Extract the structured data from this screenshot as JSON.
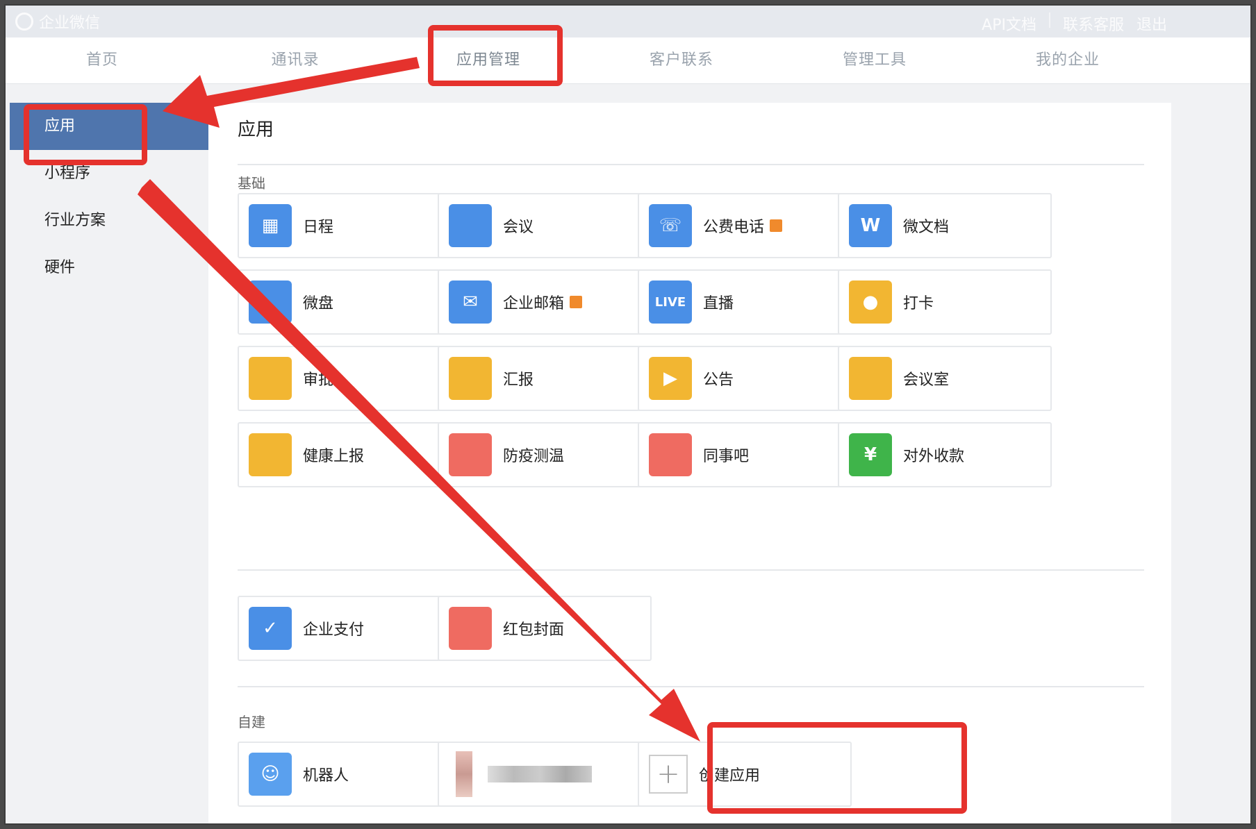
{
  "brand": {
    "name": "企业微信"
  },
  "toplinks": [
    "API文档",
    "联系客服",
    "退出"
  ],
  "nav": [
    "首页",
    "通讯录",
    "应用管理",
    "客户联系",
    "管理工具",
    "我的企业"
  ],
  "sidebar": [
    "应用",
    "小程序",
    "行业方案",
    "硬件"
  ],
  "content": {
    "title": "应用",
    "basic_label": "基础",
    "self_label": "自建",
    "apps": [
      {
        "label": "日程",
        "icon": "calendar-icon",
        "color": "#4a8fe6"
      },
      {
        "label": "会议",
        "icon": "cloud-meeting-icon",
        "color": "#4a8fe6"
      },
      {
        "label": "公费电话",
        "icon": "phone-icon",
        "color": "#4a8fe6",
        "badge": true
      },
      {
        "label": "微文档",
        "icon": "word-icon",
        "color": "#4a8fe6"
      },
      {
        "label": "微盘",
        "icon": "drive-icon",
        "color": "#4a8fe6"
      },
      {
        "label": "企业邮箱",
        "icon": "mail-icon",
        "color": "#4a8fe6",
        "badge": true
      },
      {
        "label": "直播",
        "icon": "live-icon",
        "color": "#4a8fe6"
      },
      {
        "label": "打卡",
        "icon": "location-icon",
        "color": "#f2b632"
      },
      {
        "label": "审批",
        "icon": "stamp-icon",
        "color": "#f2b632"
      },
      {
        "label": "汇报",
        "icon": "report-icon",
        "color": "#f2b632"
      },
      {
        "label": "公告",
        "icon": "megaphone-icon",
        "color": "#f2b632"
      },
      {
        "label": "会议室",
        "icon": "door-icon",
        "color": "#f2b632"
      },
      {
        "label": "健康上报",
        "icon": "health-icon",
        "color": "#f2b632"
      },
      {
        "label": "防疫测温",
        "icon": "thermometer-icon",
        "color": "#ef6b61"
      },
      {
        "label": "同事吧",
        "icon": "community-icon",
        "color": "#ef6b61"
      },
      {
        "label": "对外收款",
        "icon": "yuan-shield-icon",
        "color": "#3fb44a"
      }
    ],
    "pay_apps": [
      {
        "label": "企业支付",
        "icon": "pay-check-icon",
        "color": "#4a8fe6"
      },
      {
        "label": "红包封面",
        "icon": "red-envelope-icon",
        "color": "#ef6b61"
      }
    ],
    "self_apps": [
      {
        "label": "机器人",
        "icon": "robot-icon",
        "color": "#5aa0ee"
      }
    ],
    "create_label": "创建应用"
  }
}
